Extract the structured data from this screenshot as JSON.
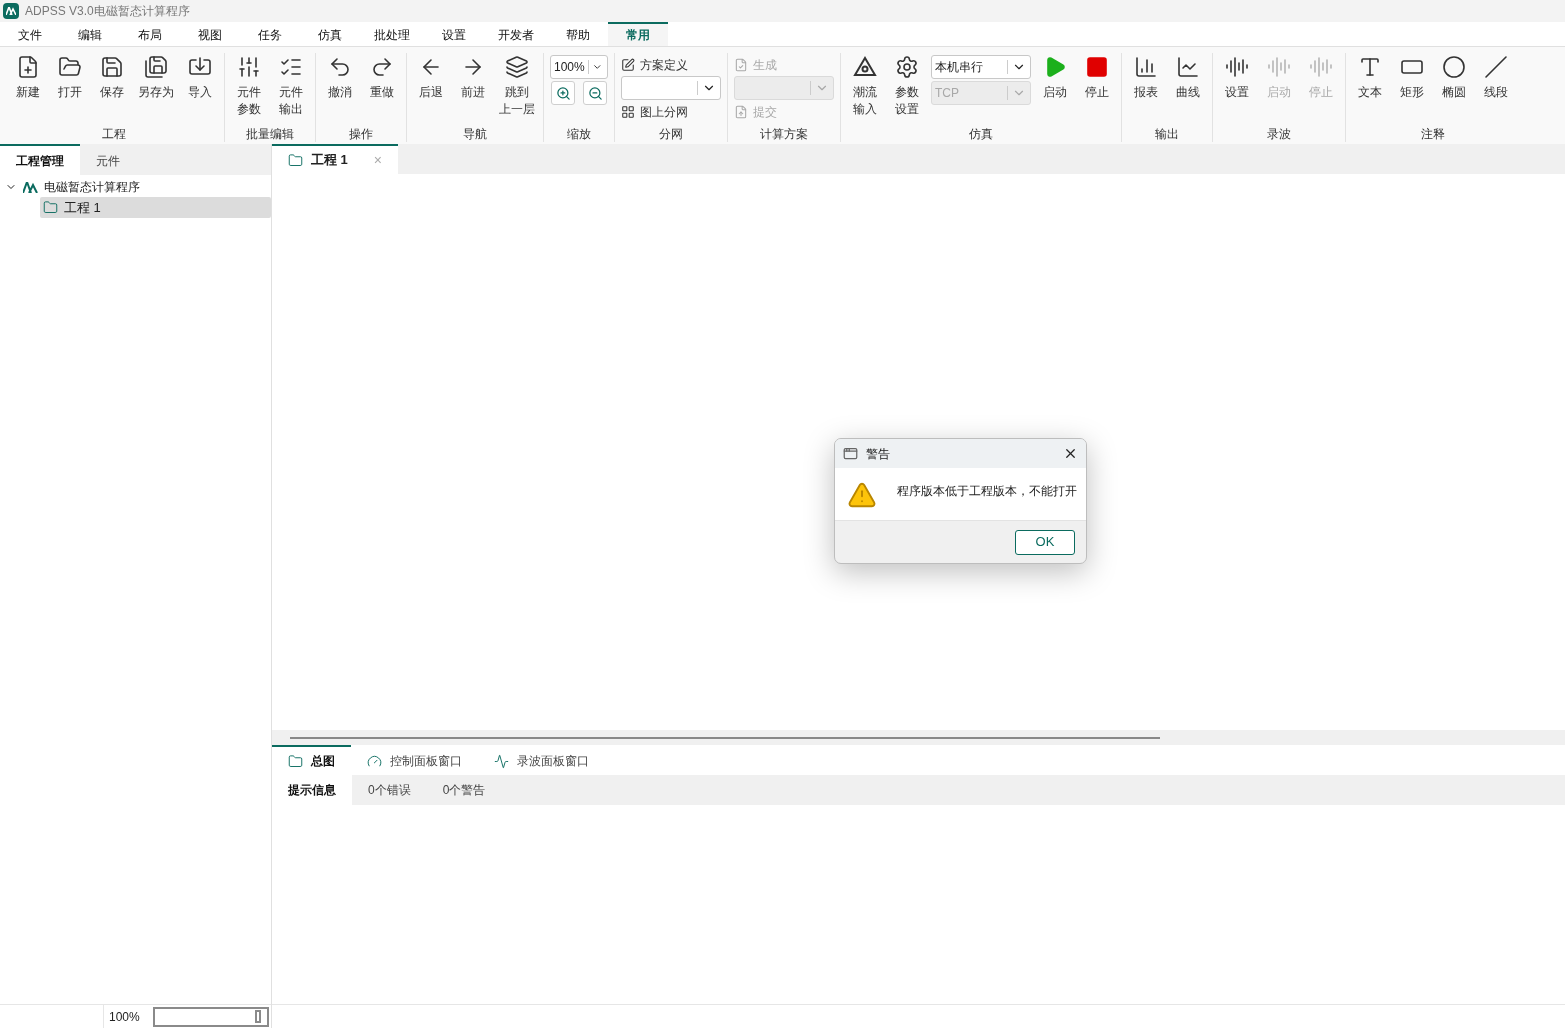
{
  "window": {
    "title": "ADPSS V3.0电磁暂态计算程序"
  },
  "menu": [
    {
      "label": "文件",
      "selected": false
    },
    {
      "label": "编辑",
      "selected": false
    },
    {
      "label": "布局",
      "selected": false
    },
    {
      "label": "视图",
      "selected": false
    },
    {
      "label": "任务",
      "selected": false
    },
    {
      "label": "仿真",
      "selected": false
    },
    {
      "label": "批处理",
      "selected": false
    },
    {
      "label": "设置",
      "selected": false
    },
    {
      "label": "开发者",
      "selected": false
    },
    {
      "label": "帮助",
      "selected": false
    },
    {
      "label": "常用",
      "selected": true
    }
  ],
  "ribbon": {
    "groups": [
      {
        "title": "工程",
        "items": [
          {
            "kind": "large",
            "label": "新建",
            "disabled": false
          },
          {
            "kind": "large",
            "label": "打开",
            "disabled": false
          },
          {
            "kind": "large",
            "label": "保存",
            "disabled": false
          },
          {
            "kind": "large",
            "label": "另存为",
            "disabled": false
          },
          {
            "kind": "large",
            "label": "导入",
            "disabled": false
          }
        ]
      },
      {
        "title": "批量编辑",
        "items": [
          {
            "kind": "large",
            "lines": [
              "元件",
              "参数"
            ],
            "disabled": false
          },
          {
            "kind": "large",
            "lines": [
              "元件",
              "输出"
            ],
            "disabled": false
          }
        ]
      },
      {
        "title": "操作",
        "items": [
          {
            "kind": "large",
            "label": "撤消",
            "disabled": false
          },
          {
            "kind": "large",
            "label": "重做",
            "disabled": false
          }
        ]
      },
      {
        "title": "导航",
        "items": [
          {
            "kind": "large",
            "label": "后退",
            "disabled": false
          },
          {
            "kind": "large",
            "label": "前进",
            "disabled": false
          },
          {
            "kind": "large",
            "lines": [
              "跳到",
              "上一层"
            ],
            "disabled": false
          }
        ]
      },
      {
        "title": "缩放",
        "items": [
          {
            "kind": "stack",
            "children": [
              {
                "kind": "combo",
                "value": "100%",
                "disabled": false
              },
              {
                "kind": "icons"
              }
            ]
          }
        ]
      },
      {
        "title": "分网",
        "items": [
          {
            "kind": "stack",
            "children": [
              {
                "kind": "small",
                "label": "方案定义",
                "disabled": false
              },
              {
                "kind": "combo",
                "disabled": false
              },
              {
                "kind": "small",
                "label": "图上分网",
                "disabled": false
              }
            ]
          }
        ]
      },
      {
        "title": "计算方案",
        "items": [
          {
            "kind": "stack",
            "children": [
              {
                "kind": "small",
                "label": "生成",
                "disabled": true
              },
              {
                "kind": "combo",
                "disabled": true
              },
              {
                "kind": "small",
                "label": "提交",
                "disabled": true
              }
            ]
          }
        ]
      },
      {
        "title": "仿真",
        "items": [
          {
            "kind": "large",
            "lines": [
              "潮流",
              "输入"
            ],
            "disabled": false
          },
          {
            "kind": "large",
            "lines": [
              "参数",
              "设置"
            ],
            "disabled": false
          },
          {
            "kind": "stack",
            "children": [
              {
                "kind": "combo",
                "value": "本机串行",
                "disabled": false
              },
              {
                "kind": "combo",
                "value": "TCP",
                "disabled": true
              }
            ]
          },
          {
            "kind": "large",
            "label": "启动",
            "disabled": false
          },
          {
            "kind": "large",
            "label": "停止",
            "disabled": false
          }
        ]
      },
      {
        "title": "输出",
        "items": [
          {
            "kind": "large",
            "label": "报表",
            "disabled": false
          },
          {
            "kind": "large",
            "label": "曲线",
            "disabled": false
          }
        ]
      },
      {
        "title": "录波",
        "items": [
          {
            "kind": "large",
            "label": "设置",
            "disabled": false
          },
          {
            "kind": "large",
            "label": "启动",
            "disabled": true
          },
          {
            "kind": "large",
            "label": "停止",
            "disabled": true
          }
        ]
      },
      {
        "title": "注释",
        "items": [
          {
            "kind": "large",
            "label": "文本",
            "disabled": false
          },
          {
            "kind": "large",
            "label": "矩形",
            "disabled": false
          },
          {
            "kind": "large",
            "label": "椭圆",
            "disabled": false
          },
          {
            "kind": "large",
            "label": "线段",
            "disabled": false
          }
        ]
      }
    ]
  },
  "left_panel": {
    "tabs": [
      {
        "label": "工程管理",
        "selected": true
      },
      {
        "label": "元件",
        "selected": false
      }
    ],
    "tree": [
      {
        "label": "电磁暂态计算程序",
        "expanded": true,
        "selected": false,
        "children": [
          {
            "label": "工程 1",
            "selected": true
          }
        ]
      }
    ]
  },
  "document_tabs": [
    {
      "label": "工程 1",
      "selected": true,
      "close": "×"
    }
  ],
  "bottom_tabs": [
    {
      "label": "总图",
      "selected": true
    },
    {
      "label": "控制面板窗口",
      "selected": false
    },
    {
      "label": "录波面板窗口",
      "selected": false
    }
  ],
  "message_tabs": [
    {
      "label": "提示信息",
      "selected": true
    },
    {
      "label": "0个错误",
      "selected": false
    },
    {
      "label": "0个警告",
      "selected": false
    }
  ],
  "status_bar": {
    "zoom": "100%"
  },
  "dialog": {
    "title": "警告",
    "message": "程序版本低于工程版本，不能打开",
    "buttons": [
      "OK"
    ]
  }
}
